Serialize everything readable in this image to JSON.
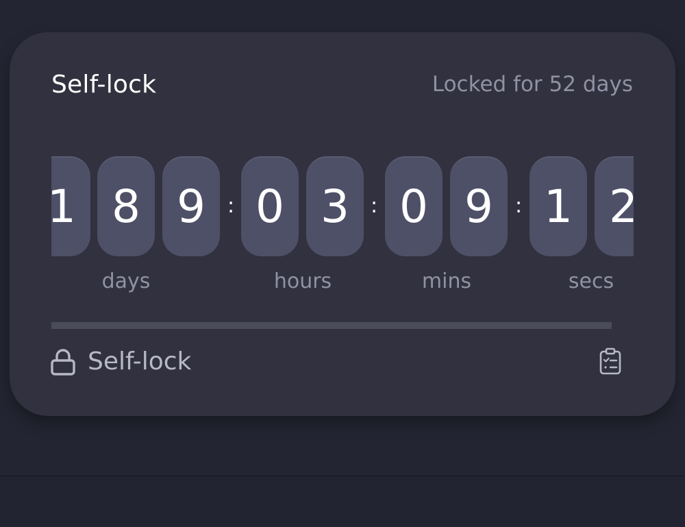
{
  "card": {
    "title": "Self-lock",
    "status": "Locked for 52 days"
  },
  "countdown": {
    "days": [
      "1",
      "8",
      "9"
    ],
    "hours": [
      "0",
      "3"
    ],
    "mins": [
      "0",
      "9"
    ],
    "secs": [
      "1",
      "2"
    ],
    "separator": ":",
    "labels": {
      "days": "days",
      "hours": "hours",
      "mins": "mins",
      "secs": "secs"
    }
  },
  "progress": {
    "fraction": 1.0
  },
  "footer": {
    "label": "Self-lock",
    "left_icon": "lock-icon",
    "right_icon": "clipboard-checklist-icon"
  },
  "colors": {
    "background": "#232632",
    "card": "#31313f",
    "digit_tile": "#4e5067",
    "muted_text": "#8f92a3",
    "progress": "#4b4c5a"
  }
}
